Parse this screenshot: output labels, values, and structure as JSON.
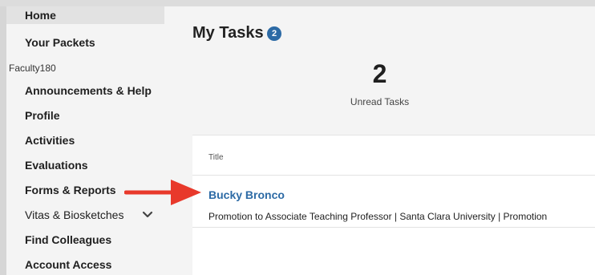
{
  "sidebar": {
    "items_top": [
      {
        "label": "Home",
        "active": true
      },
      {
        "label": "Your Packets"
      }
    ],
    "section_label": "Faculty180",
    "items": [
      {
        "label": "Announcements & Help"
      },
      {
        "label": "Profile"
      },
      {
        "label": "Activities"
      },
      {
        "label": "Evaluations"
      },
      {
        "label": "Forms & Reports"
      },
      {
        "label": "Vitas & Biosketches",
        "expandable": true
      },
      {
        "label": "Find Colleagues"
      },
      {
        "label": "Account Access"
      }
    ]
  },
  "main": {
    "title": "My Tasks",
    "badge_count": "2",
    "stat_value": "2",
    "stat_label": "Unread Tasks",
    "table": {
      "column_header": "Title",
      "rows": [
        {
          "name": "Bucky Bronco",
          "description": "Promotion to Associate Teaching Professor | Santa Clara University | Promotion"
        }
      ]
    }
  },
  "colors": {
    "accent": "#2c6aa5",
    "arrow": "#e8392b"
  },
  "icons": {
    "expand": "chevron-down-icon",
    "pointer": "red-arrow-icon"
  }
}
